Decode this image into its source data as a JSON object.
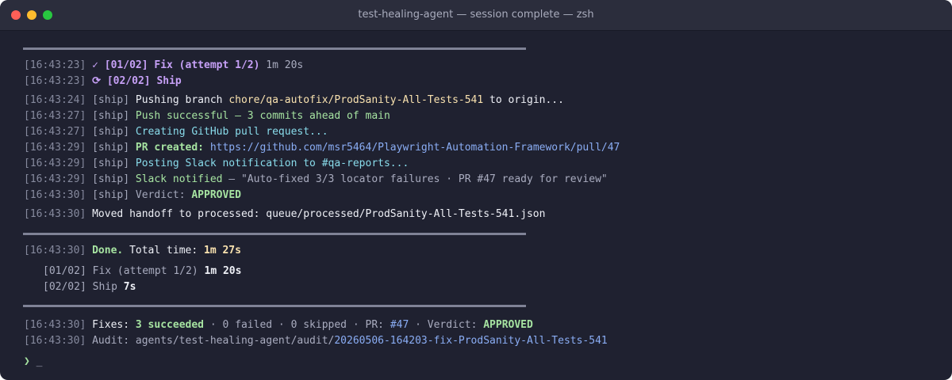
{
  "window": {
    "title": "test-healing-agent — session complete — zsh"
  },
  "steps": [
    {
      "ts": "[16:43:23]",
      "icon_glyph": "✓",
      "icon": "check-icon",
      "label": "[01/02] Fix (attempt 1/2)",
      "duration": "1m 20s"
    },
    {
      "ts": "[16:43:23]",
      "icon_glyph": "⟳",
      "icon": "spinner-icon",
      "label": "[02/02] Ship"
    }
  ],
  "ship_log": [
    {
      "ts": "[16:43:24]",
      "tag": "[ship]",
      "pre": "Pushing branch ",
      "branch": "chore/qa-autofix/ProdSanity-All-Tests-541",
      "post": " to origin..."
    },
    {
      "ts": "[16:43:27]",
      "tag": "[ship]",
      "text": "Push successful — 3 commits ahead of main"
    },
    {
      "ts": "[16:43:27]",
      "tag": "[ship]",
      "text": "Creating GitHub pull request..."
    },
    {
      "ts": "[16:43:29]",
      "tag": "[ship]",
      "label": "PR created:",
      "url": "https://github.com/msr5464/Playwright-Automation-Framework/pull/47"
    },
    {
      "ts": "[16:43:29]",
      "tag": "[ship]",
      "text": "Posting Slack notification to #qa-reports..."
    },
    {
      "ts": "[16:43:29]",
      "tag": "[ship]",
      "label": "Slack notified",
      "rest": " — \"Auto-fixed 3/3 locator failures · PR #47 ready for review\""
    },
    {
      "ts": "[16:43:30]",
      "tag": "[ship]",
      "label": "Verdict: ",
      "verdict": "APPROVED"
    }
  ],
  "handoff": {
    "ts": "[16:43:30]",
    "text": "Moved handoff to processed: queue/processed/ProdSanity-All-Tests-541.json"
  },
  "summary": {
    "ts": "[16:43:30]",
    "done": "Done.",
    "total_label": " Total time: ",
    "total": "1m 27s",
    "items": [
      {
        "label": "[01/02] Fix (attempt 1/2) ",
        "time": "1m 20s"
      },
      {
        "label": "[02/02] Ship ",
        "time": "7s"
      }
    ]
  },
  "final": {
    "ts": "[16:43:30]",
    "fixes_label": "Fixes: ",
    "succeeded": "3 succeeded",
    "mid": " · 0 failed · 0 skipped · PR: ",
    "pr": "#47",
    "verdict_label": " · Verdict: ",
    "verdict": "APPROVED",
    "audit_ts": "[16:43:30]",
    "audit_label": "Audit: agents/test-healing-agent/audit/",
    "audit_path": "20260506-164203-fix-ProdSanity-All-Tests-541"
  },
  "prompt": {
    "glyph": "❯",
    "icon": "prompt-chevron-icon",
    "cursor": "_"
  },
  "colors": {
    "background": "#1f2130",
    "titlebar": "#2b2d3c",
    "purple": "#c6a0f6",
    "green": "#a6e3a1",
    "yellow": "#f9e2af",
    "cyan": "#89dceb",
    "blue": "#8aadf4"
  }
}
